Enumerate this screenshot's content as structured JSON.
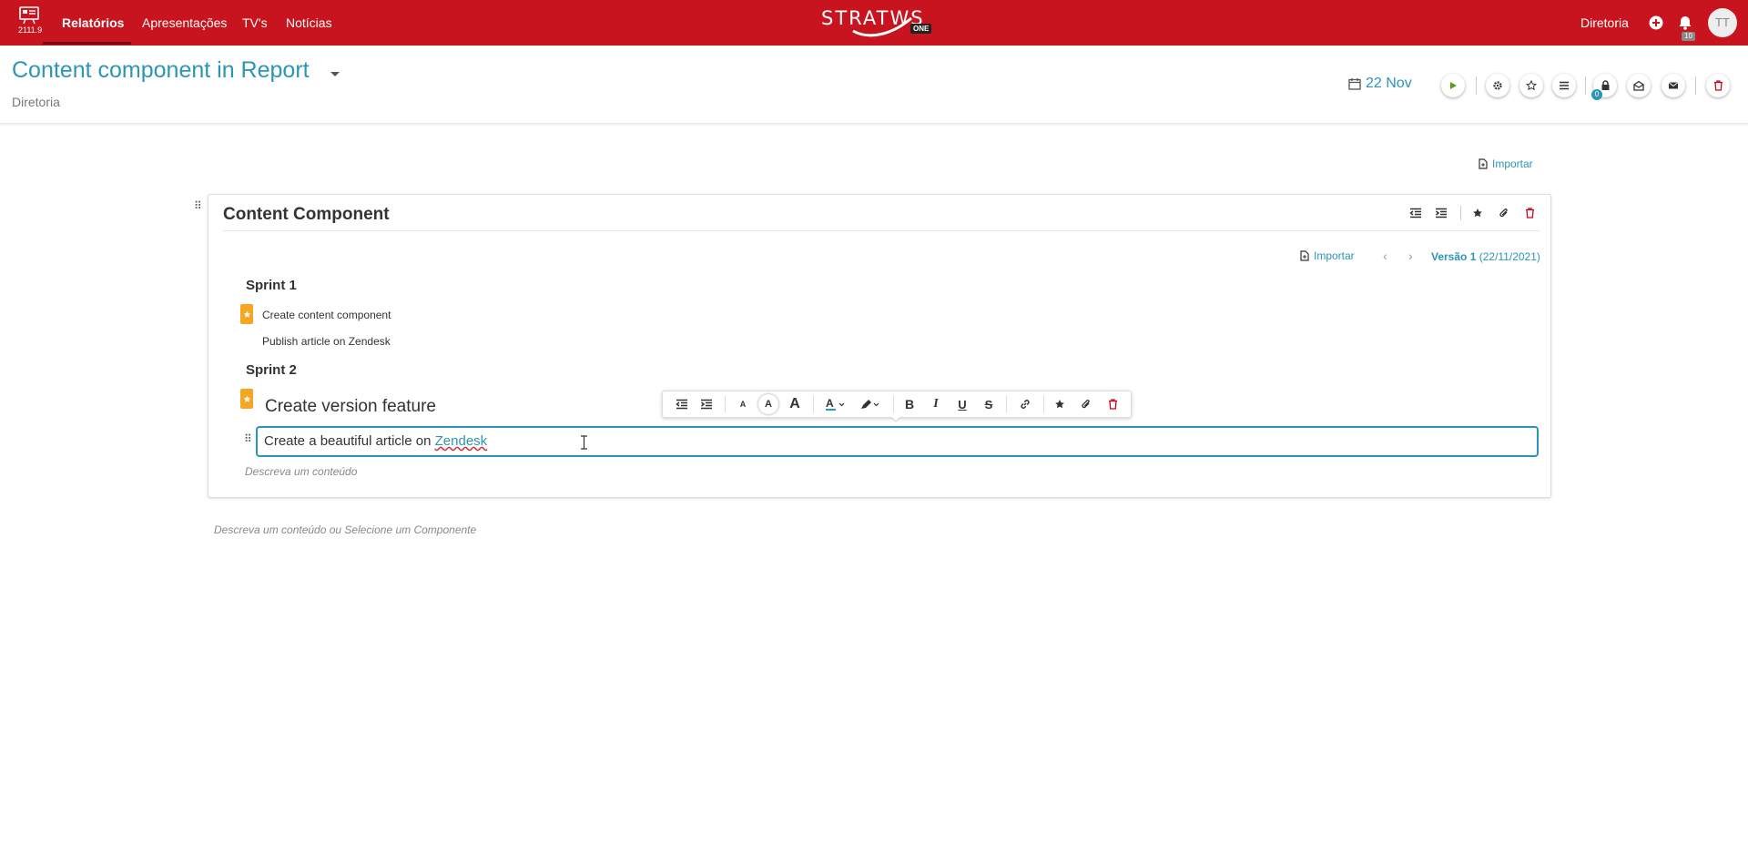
{
  "topbar": {
    "version": "2111.9",
    "nav": [
      "Relatórios",
      "Apresentações",
      "TV's",
      "Notícias"
    ],
    "brand": "STRATWS",
    "brand_badge": "ONE",
    "org": "Diretoria",
    "notifications": "10",
    "avatar_initials": "TT",
    "bg_color": "#c8141e"
  },
  "header": {
    "title": "Content component in Report",
    "subtitle": "Diretoria",
    "date": "22 Nov",
    "lock_count": "0",
    "accent_color": "#2d95b5"
  },
  "main": {
    "import_label": "Importar",
    "empty_hint": "Descreva um conteúdo ou Selecione um Componente"
  },
  "component": {
    "title": "Content Component",
    "import_label": "Importar",
    "version_label": "Versão 1",
    "version_date": "(22/11/2021)",
    "sprint1": {
      "title": "Sprint 1",
      "items": [
        "Create content component",
        "Publish article on Zendesk"
      ]
    },
    "sprint2": {
      "title": "Sprint 2",
      "items": [
        "Create version feature"
      ]
    },
    "editor": {
      "text_before": "Create a beautiful article on ",
      "link_text": "Zendesk"
    },
    "placeholder": "Descreva um conteúdo",
    "star_color": "#f5a623"
  }
}
